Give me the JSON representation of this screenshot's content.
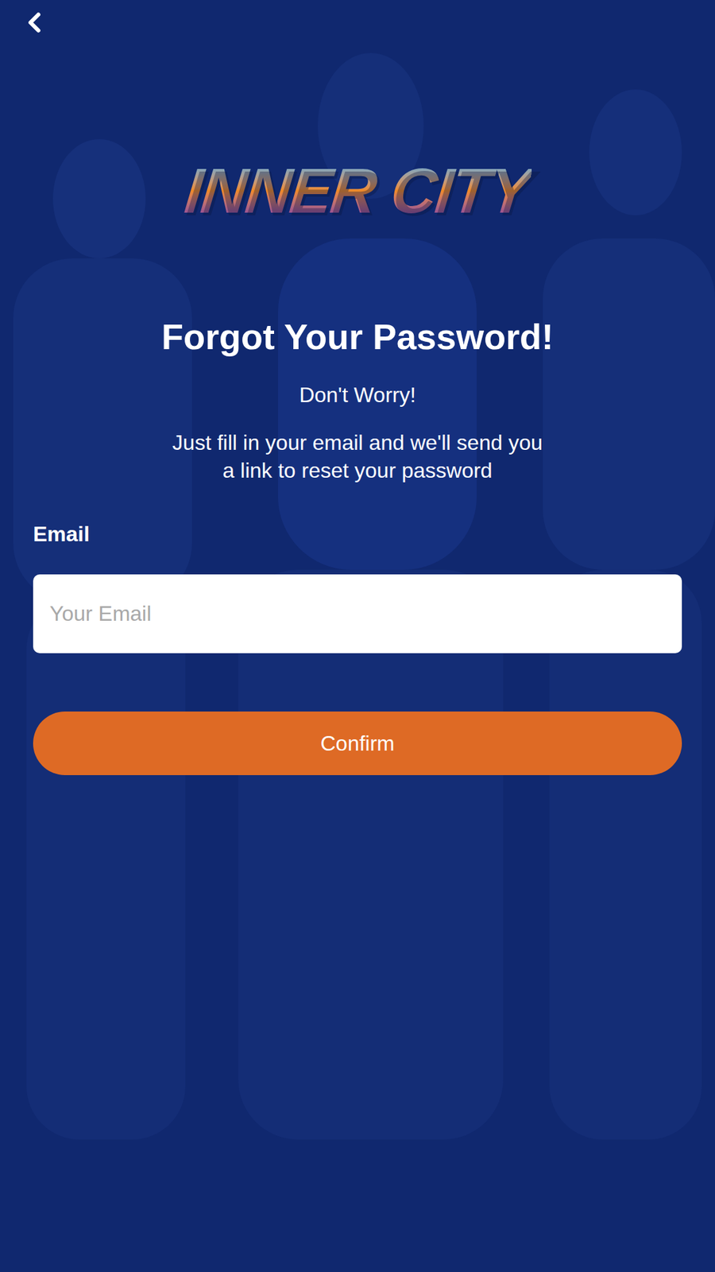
{
  "logo": {
    "text": "INNER CITY"
  },
  "title": "Forgot Your Password!",
  "subtitle": "Don't Worry!",
  "description": [
    "Just fill in your email and we'll send you",
    "a link to reset your password"
  ],
  "form": {
    "fields": [
      {
        "label": "Email",
        "placeholder": "Your Email",
        "value": ""
      }
    ]
  },
  "buttons": [
    {
      "label": "Confirm"
    }
  ]
}
